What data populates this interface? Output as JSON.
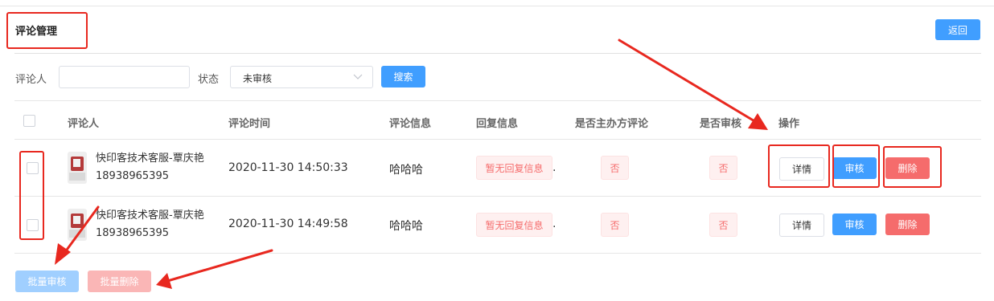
{
  "header": {
    "title": "评论管理",
    "back_label": "返回"
  },
  "filters": {
    "commenter_label": "评论人",
    "commenter_value": "",
    "status_label": "状态",
    "status_value": "未审核",
    "search_label": "搜索"
  },
  "table": {
    "columns": [
      "评论人",
      "评论时间",
      "评论信息",
      "回复信息",
      "是否主办方评论",
      "是否审核",
      "操作"
    ],
    "rows": [
      {
        "commenter": "快印客技术客服-覃庆艳18938965395",
        "time": "2020-11-30 14:50:33",
        "content": "哈哈哈",
        "reply": "暂无回复信息",
        "reply_suffix": ".",
        "is_organizer": "否",
        "is_reviewed": "否",
        "actions": {
          "detail": "详情",
          "review": "审核",
          "delete": "删除"
        }
      },
      {
        "commenter": "快印客技术客服-覃庆艳18938965395",
        "time": "2020-11-30 14:49:58",
        "content": "哈哈哈",
        "reply": "暂无回复信息",
        "reply_suffix": ".",
        "is_organizer": "否",
        "is_reviewed": "否",
        "actions": {
          "detail": "详情",
          "review": "审核",
          "delete": "删除"
        }
      }
    ]
  },
  "bulk": {
    "review_label": "批量审核",
    "delete_label": "批量删除"
  },
  "colors": {
    "primary": "#409eff",
    "danger": "#f56c6c",
    "annotation": "#e8281f"
  },
  "icons": {
    "select_arrow": "chevron-down-icon",
    "avatar": "avatar-image"
  }
}
